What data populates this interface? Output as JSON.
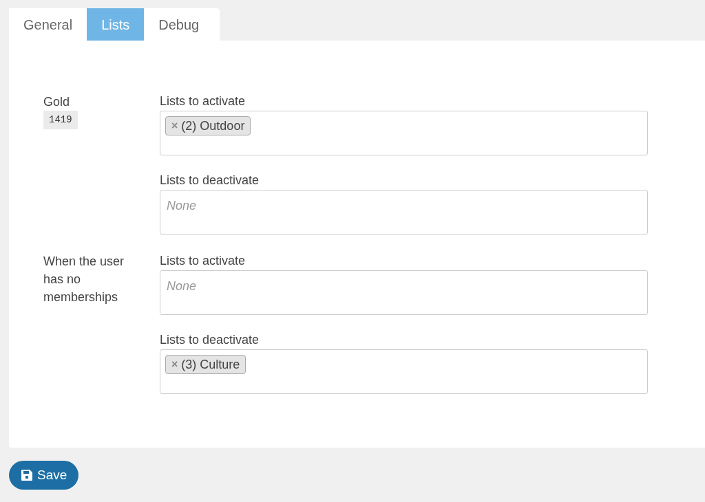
{
  "tabs": [
    {
      "label": "General",
      "selected": false
    },
    {
      "label": "Lists",
      "selected": true
    },
    {
      "label": "Debug",
      "selected": false
    }
  ],
  "sections": [
    {
      "label": "Gold",
      "code": "1419",
      "fields": [
        {
          "label": "Lists to activate",
          "tags": [
            {
              "remove": "×",
              "text": "(2) Outdoor"
            }
          ]
        },
        {
          "label": "Lists to deactivate",
          "placeholder": "None"
        }
      ]
    },
    {
      "label": "When the user has no memberships",
      "fields": [
        {
          "label": "Lists to activate",
          "placeholder": "None"
        },
        {
          "label": "Lists to deactivate",
          "tags": [
            {
              "remove": "×",
              "text": "(3) Culture"
            }
          ]
        }
      ]
    }
  ],
  "save_button": "Save"
}
